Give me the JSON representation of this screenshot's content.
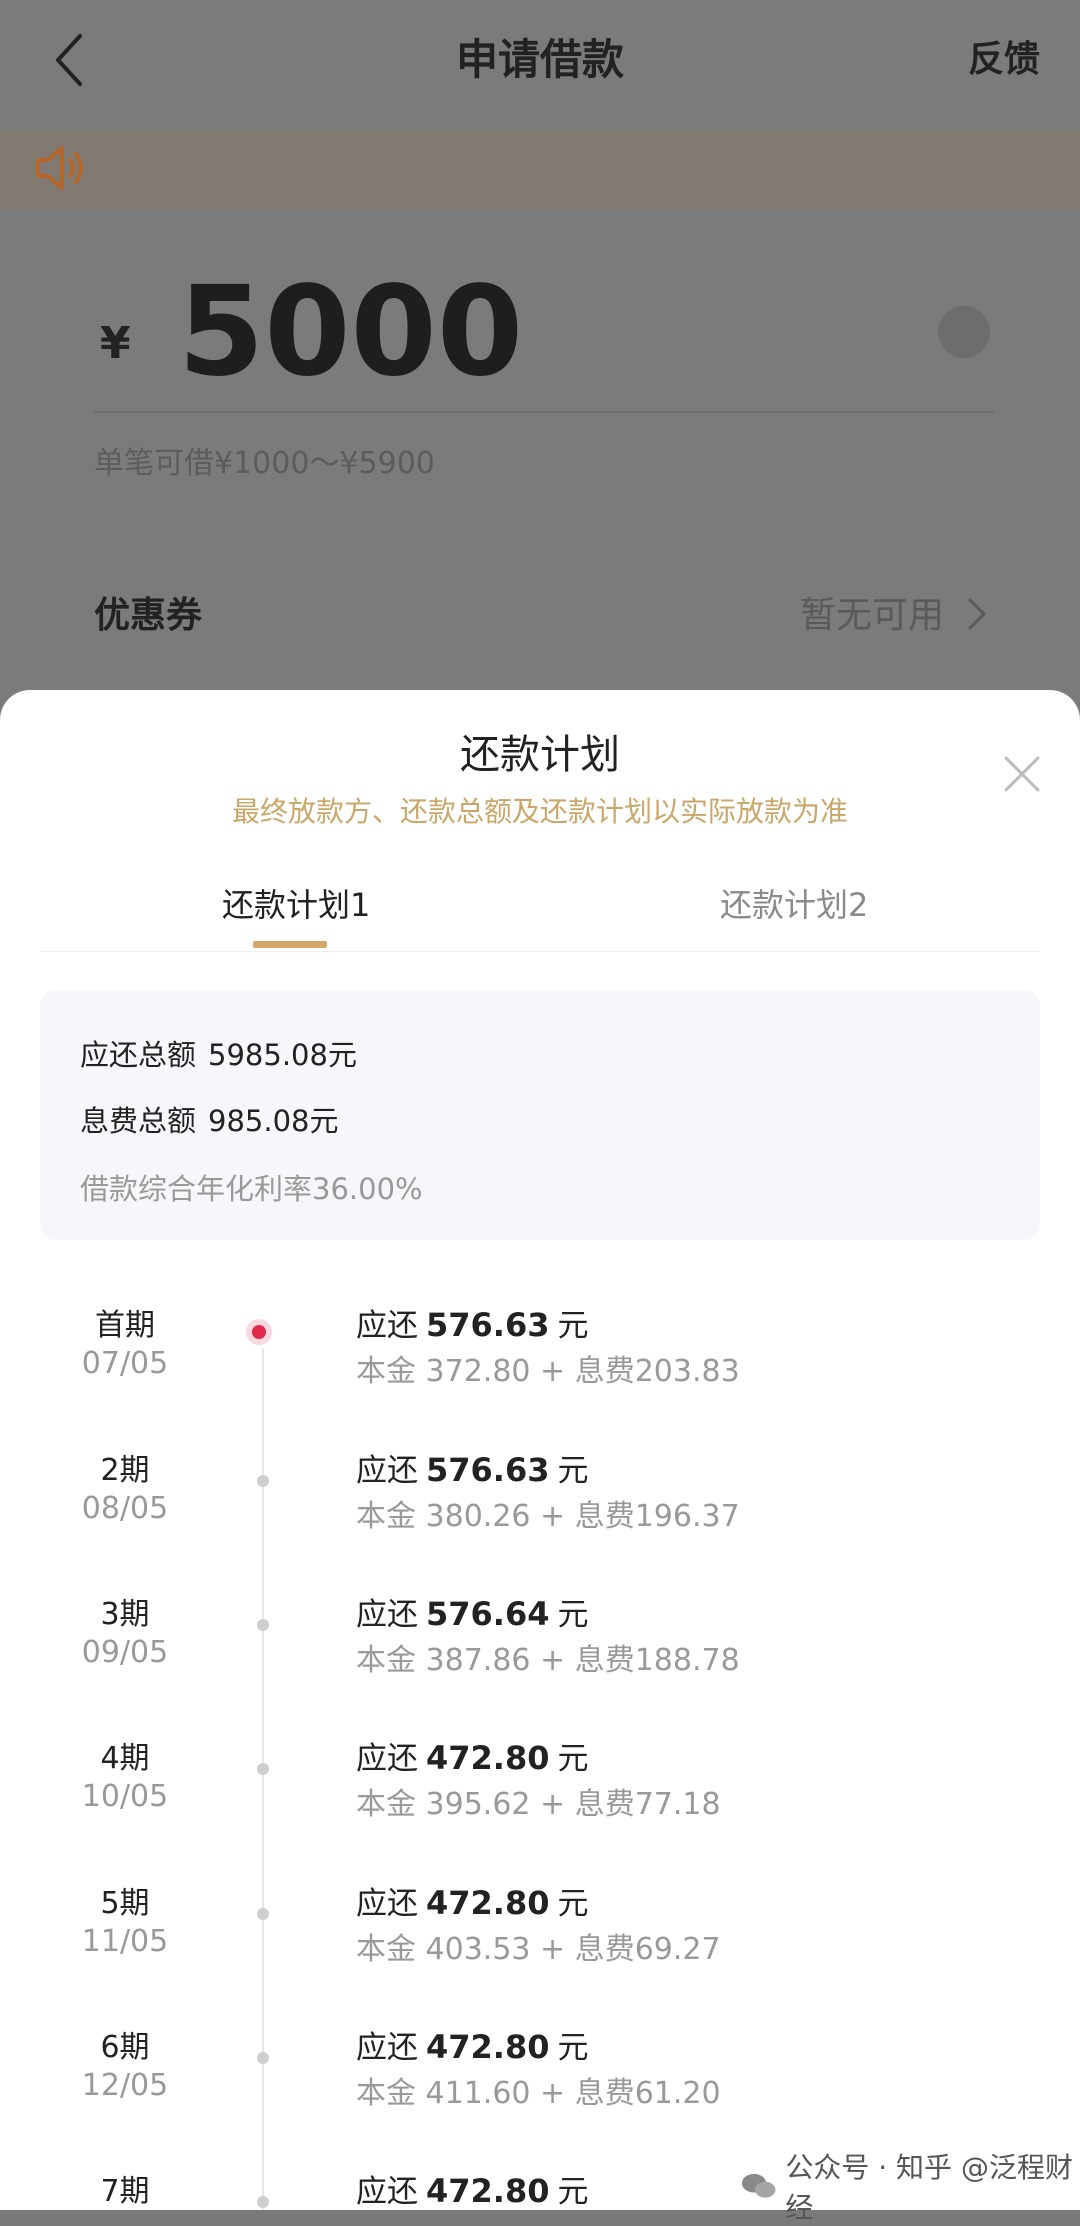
{
  "header": {
    "title": "申请借款",
    "feedback_label": "反馈"
  },
  "loan": {
    "currency_symbol": "¥",
    "amount": "5000",
    "range_hint": "单笔可借¥1000～¥5900"
  },
  "coupon": {
    "label": "优惠券",
    "value": "暂无可用"
  },
  "sheet": {
    "title": "还款计划",
    "subtitle": "最终放款方、还款总额及还款计划以实际放款为准",
    "tabs": [
      {
        "label": "还款计划1",
        "active": true
      },
      {
        "label": "还款计划2",
        "active": false
      }
    ],
    "summary": {
      "total_due_label": "应还总额",
      "total_due_value": "5985.08元",
      "total_fee_label": "息费总额",
      "total_fee_value": "985.08元",
      "apr_text": "借款综合年化利率36.00%"
    },
    "periods": [
      {
        "name": "首期",
        "date": "07/05",
        "due_prefix": "应还",
        "due": "576.63",
        "unit": "元",
        "detail": "本金 372.80 + 息费203.83"
      },
      {
        "name": "2期",
        "date": "08/05",
        "due_prefix": "应还",
        "due": "576.63",
        "unit": "元",
        "detail": "本金 380.26 + 息费196.37"
      },
      {
        "name": "3期",
        "date": "09/05",
        "due_prefix": "应还",
        "due": "576.64",
        "unit": "元",
        "detail": "本金 387.86 + 息费188.78"
      },
      {
        "name": "4期",
        "date": "10/05",
        "due_prefix": "应还",
        "due": "472.80",
        "unit": "元",
        "detail": "本金 395.62 + 息费77.18"
      },
      {
        "name": "5期",
        "date": "11/05",
        "due_prefix": "应还",
        "due": "472.80",
        "unit": "元",
        "detail": "本金 403.53 + 息费69.27"
      },
      {
        "name": "6期",
        "date": "12/05",
        "due_prefix": "应还",
        "due": "472.80",
        "unit": "元",
        "detail": "本金 411.60 + 息费61.20"
      },
      {
        "name": "7期",
        "date": "",
        "due_prefix": "应还",
        "due": "472.80",
        "unit": "元",
        "detail": ""
      }
    ]
  },
  "watermark": {
    "text": "公众号 · 知乎 @泛程财经"
  },
  "colors": {
    "accent_gold": "#d6a767",
    "subtitle_gold": "#c9a769",
    "active_dot": "#e0294b",
    "overlay_dim": "#7b7b7b"
  }
}
